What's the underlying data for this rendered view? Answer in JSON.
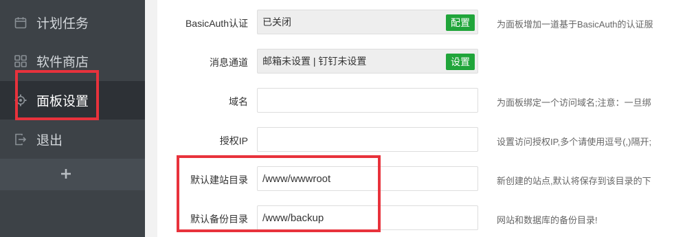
{
  "sidebar": {
    "items": [
      {
        "label": "计划任务",
        "icon": "calendar-icon",
        "active": false
      },
      {
        "label": "软件商店",
        "icon": "grid-icon",
        "active": false
      },
      {
        "label": "面板设置",
        "icon": "gear-icon",
        "active": true
      },
      {
        "label": "退出",
        "icon": "exit-icon",
        "active": false
      }
    ],
    "add_icon": "plus-icon"
  },
  "settings": {
    "basic_auth": {
      "label": "BasicAuth认证",
      "value": "已关闭",
      "button": "配置",
      "hint": "为面板增加一道基于BasicAuth的认证服"
    },
    "message_channel": {
      "label": "消息通道",
      "value": "邮箱未设置 | 钉钉未设置",
      "button": "设置"
    },
    "domain": {
      "label": "域名",
      "value": "",
      "hint": "为面板绑定一个访问域名;注意：一旦绑"
    },
    "auth_ip": {
      "label": "授权IP",
      "value": "",
      "hint": "设置访问授权IP,多个请使用逗号(,)隔开;"
    },
    "default_site_dir": {
      "label": "默认建站目录",
      "value": "/www/wwwroot",
      "hint": "新创建的站点,默认将保存到该目录的下"
    },
    "default_backup_dir": {
      "label": "默认备份目录",
      "value": "/www/backup",
      "hint": "网站和数据库的备份目录!"
    }
  },
  "colors": {
    "sidebar_bg": "#3d4247",
    "sidebar_active": "#2d3136",
    "accent_green": "#20a53a",
    "highlight_red": "#e8323c"
  }
}
